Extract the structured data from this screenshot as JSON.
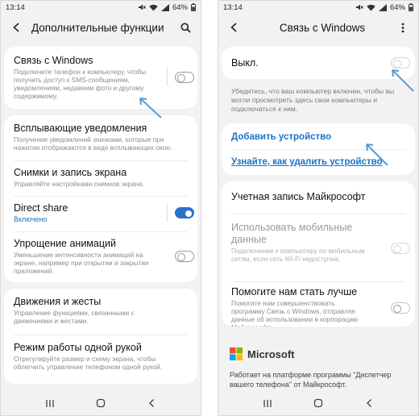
{
  "left_screen": {
    "status": {
      "time": "13:14",
      "battery": "64%"
    },
    "header": {
      "title": "Дополнительные функции"
    },
    "items": [
      {
        "title": "Связь с Windows",
        "subtitle": "Подключите телефон к компьютеру, чтобы получить доступ к SMS-сообщениям, уведомлениям, недавним фото и другому содержимому."
      },
      {
        "title": "Всплывающие уведомления",
        "subtitle": "Получение уведомлений значками, которые при нажатии отображаются в виде всплывающих окон."
      },
      {
        "title": "Снимки и запись экрана",
        "subtitle": "Управляйте настройками снимков экрана."
      },
      {
        "title": "Direct share",
        "subtitle": "Включено"
      },
      {
        "title": "Упрощение анимаций",
        "subtitle": "Уменьшение интенсивности анимаций на экране, например при открытии и закрытии приложений."
      },
      {
        "title": "Движения и жесты",
        "subtitle": "Управление функциями, связанными с движениями и жестами."
      },
      {
        "title": "Режим работы одной рукой",
        "subtitle": "Отрегулируйте размер и схему экрана, чтобы облегчить управление телефоном одной рукой."
      }
    ]
  },
  "right_screen": {
    "status": {
      "time": "13:14",
      "battery": "64%"
    },
    "header": {
      "title": "Связь с Windows"
    },
    "master_toggle_label": "Выкл.",
    "info": "Убедитесь, что ваш компьютер включен, чтобы вы могли просмотреть здесь свои компьютеры и подключаться к ним.",
    "add_device_link": "Добавить устройство",
    "remove_device_link": "Узнайте, как удалить устройство",
    "account": "Учетная запись Майкрософт",
    "mobile_data": {
      "title": "Использовать мобильные данные",
      "subtitle": "Подключение к компьютеру по мобильным сетям, если сеть Wi-Fi недоступна."
    },
    "improve": {
      "title": "Помогите нам стать лучше",
      "subtitle": "Помогите нам совершенствовать программу Связь с Windows, отправляя данные об использовании в корпорацию Майкрософт."
    },
    "brand": "Microsoft",
    "footer": "Работает на платформе программы \"Диспетчер вашего телефона\" от Майкрософт."
  },
  "colors": {
    "accent": "#1a73c8",
    "arrow": "#5b9bd5",
    "ms_red": "#f25022",
    "ms_green": "#7fba00",
    "ms_blue": "#00a4ef",
    "ms_yellow": "#ffb900"
  },
  "toggles": {
    "link_to_windows": false,
    "direct_share": true,
    "reduce_animations": false,
    "master": false,
    "mobile_data": false,
    "improve": false
  },
  "icons": {
    "back": "back-arrow-icon",
    "search": "search-icon",
    "more": "more-vertical-icon",
    "recents": "recents-icon",
    "home": "home-icon",
    "nav_back": "nav-back-icon"
  }
}
